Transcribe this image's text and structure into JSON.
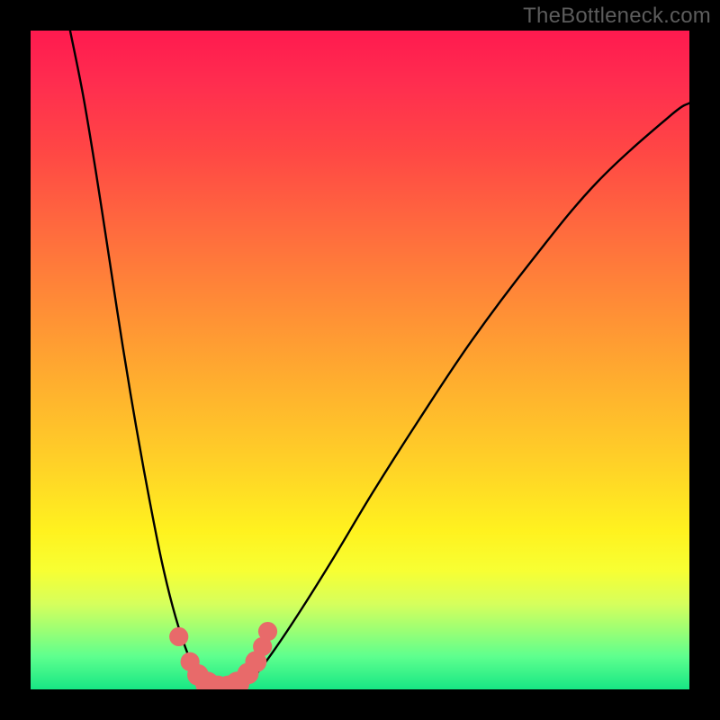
{
  "watermark": {
    "text": "TheBottleneck.com"
  },
  "chart_data": {
    "type": "line",
    "title": "",
    "xlabel": "",
    "ylabel": "",
    "xlim": [
      0,
      100
    ],
    "ylim": [
      0,
      100
    ],
    "grid": false,
    "notes": "Bottleneck-style V curve over vertical color gradient (red=high bottleneck at top → green=low at bottom). No axis ticks or numeric labels shown.",
    "gradient_stops": [
      {
        "pct": 0,
        "color": "#ff1a4f"
      },
      {
        "pct": 18,
        "color": "#ff4645"
      },
      {
        "pct": 42,
        "color": "#ff8d36"
      },
      {
        "pct": 66,
        "color": "#ffd227"
      },
      {
        "pct": 82,
        "color": "#f7ff33"
      },
      {
        "pct": 95,
        "color": "#5eff8e"
      },
      {
        "pct": 100,
        "color": "#17e784"
      }
    ],
    "series": [
      {
        "name": "left-branch",
        "x": [
          6,
          8,
          10,
          12,
          14,
          16,
          18,
          20,
          22,
          24,
          25.5,
          27
        ],
        "y": [
          100,
          90,
          78,
          65,
          52,
          40,
          29,
          19,
          11,
          5,
          2,
          0
        ]
      },
      {
        "name": "right-branch",
        "x": [
          32,
          34,
          37,
          41,
          46,
          52,
          59,
          67,
          76,
          86,
          97,
          100
        ],
        "y": [
          0,
          2,
          6,
          12,
          20,
          30,
          41,
          53,
          65,
          77,
          87,
          89
        ]
      }
    ],
    "markers": [
      {
        "x": 22.5,
        "y": 8.0,
        "r": 1.0
      },
      {
        "x": 24.2,
        "y": 4.2,
        "r": 1.0
      },
      {
        "x": 25.4,
        "y": 2.2,
        "r": 1.2
      },
      {
        "x": 26.8,
        "y": 0.9,
        "r": 1.4
      },
      {
        "x": 28.4,
        "y": 0.3,
        "r": 1.4
      },
      {
        "x": 30.0,
        "y": 0.3,
        "r": 1.4
      },
      {
        "x": 31.4,
        "y": 0.9,
        "r": 1.4
      },
      {
        "x": 33.0,
        "y": 2.4,
        "r": 1.2
      },
      {
        "x": 34.2,
        "y": 4.2,
        "r": 1.2
      },
      {
        "x": 35.2,
        "y": 6.5,
        "r": 1.0
      },
      {
        "x": 36.0,
        "y": 8.8,
        "r": 1.0
      }
    ],
    "marker_color": "#e86a6a"
  }
}
